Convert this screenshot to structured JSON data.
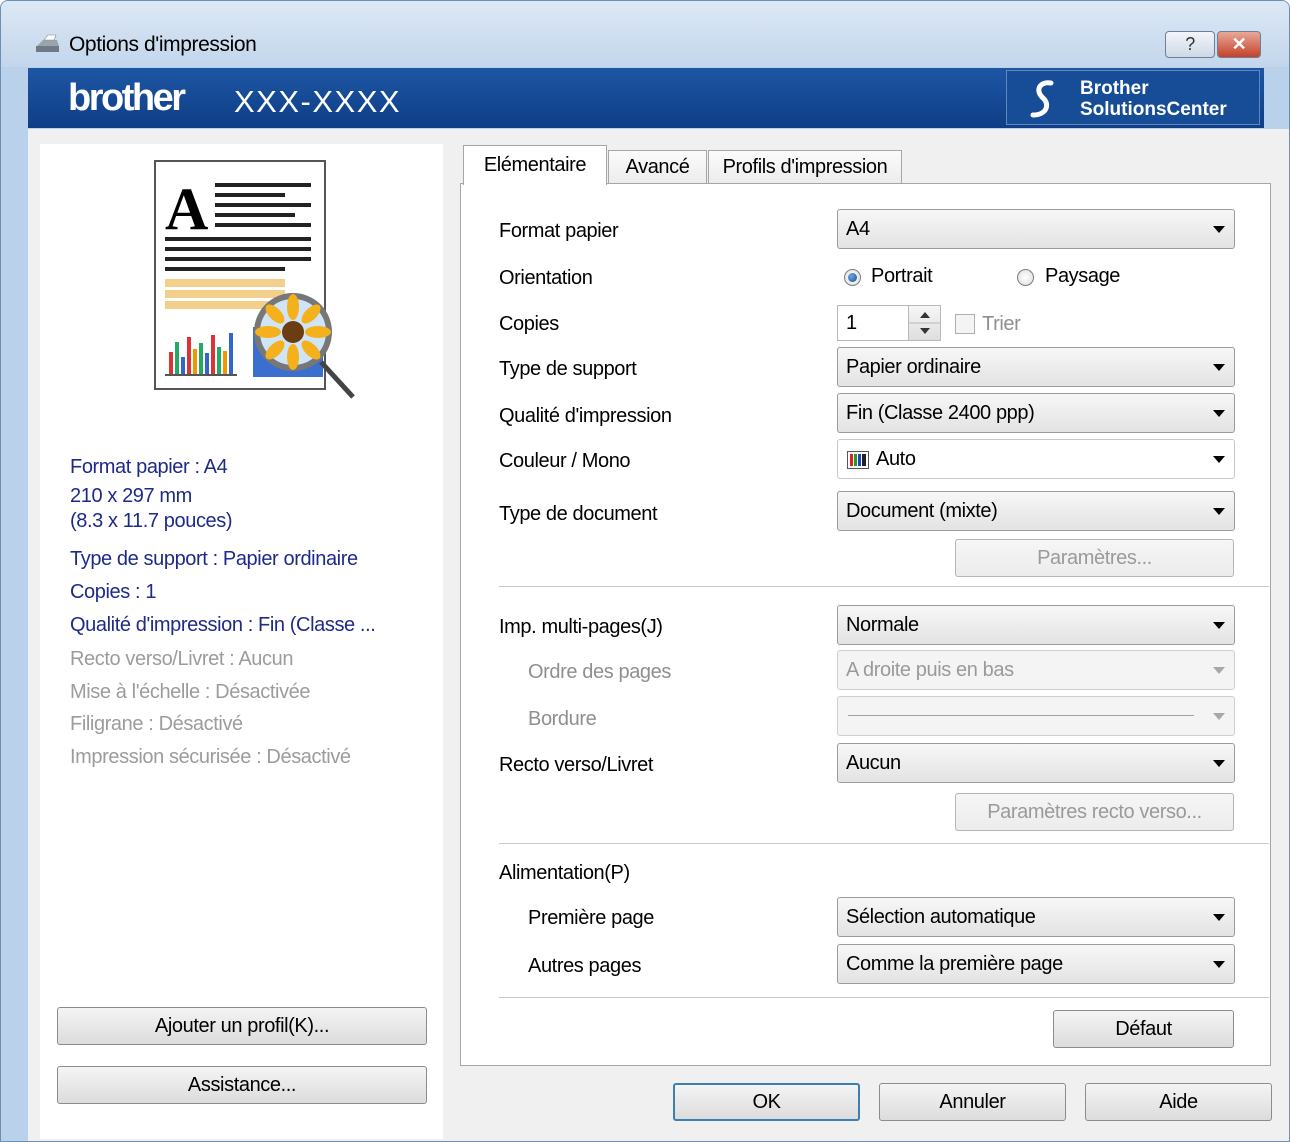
{
  "window": {
    "title": "Options d'impression",
    "help_glyph": "?",
    "close_glyph": "✕"
  },
  "banner": {
    "brand": "brother",
    "model": "XXX-XXXX",
    "solutions_line1": "Brother",
    "solutions_line2": "SolutionsCenter"
  },
  "summary": {
    "paper": "Format papier : A4",
    "dim_mm": "210 x 297 mm",
    "dim_in": "(8.3 x 11.7 pouces)",
    "media": "Type de support : Papier ordinaire",
    "copies": "Copies : 1",
    "quality": "Qualité d'impression : Fin (Classe ...",
    "duplex": "Recto verso/Livret : Aucun",
    "scaling": "Mise à l'échelle : Désactivée",
    "watermark": "Filigrane : Désactivé",
    "secure": "Impression sécurisée : Désactivé"
  },
  "left_buttons": {
    "add_profile": "Ajouter un profil(K)...",
    "support": "Assistance..."
  },
  "tabs": [
    "Elémentaire",
    "Avancé",
    "Profils d'impression"
  ],
  "form": {
    "paper_size": {
      "label": "Format papier",
      "value": "A4"
    },
    "orientation": {
      "label": "Orientation",
      "portrait": "Portrait",
      "landscape": "Paysage",
      "selected": "Portrait"
    },
    "copies": {
      "label": "Copies",
      "value": "1",
      "collate": "Trier",
      "collate_checked": false
    },
    "media_type": {
      "label": "Type de support",
      "value": "Papier ordinaire"
    },
    "print_quality": {
      "label": "Qualité d'impression",
      "value": "Fin (Classe 2400 ppp)"
    },
    "color_mono": {
      "label": "Couleur / Mono",
      "value": "Auto"
    },
    "document_type": {
      "label": "Type de document",
      "value": "Document (mixte)"
    },
    "settings_button": "Paramètres...",
    "multipage": {
      "label": "Imp. multi-pages(J)",
      "value": "Normale"
    },
    "page_order": {
      "label": "Ordre des pages",
      "value": "A droite puis en bas"
    },
    "border": {
      "label": "Bordure"
    },
    "duplex": {
      "label": "Recto verso/Livret",
      "value": "Aucun"
    },
    "duplex_settings_button": "Paramètres recto verso...",
    "paper_source": {
      "label": "Alimentation(P)"
    },
    "first_page": {
      "label": "Première page",
      "value": "Sélection automatique"
    },
    "other_pages": {
      "label": "Autres pages",
      "value": "Comme la première page"
    },
    "default_button": "Défaut"
  },
  "footer": {
    "ok": "OK",
    "cancel": "Annuler",
    "help": "Aide"
  },
  "colors": {
    "banner": "#174c97",
    "summary_active": "#1e2a8a",
    "summary_disabled": "#9c9c9c",
    "window_frame": "#b9d1ea"
  }
}
